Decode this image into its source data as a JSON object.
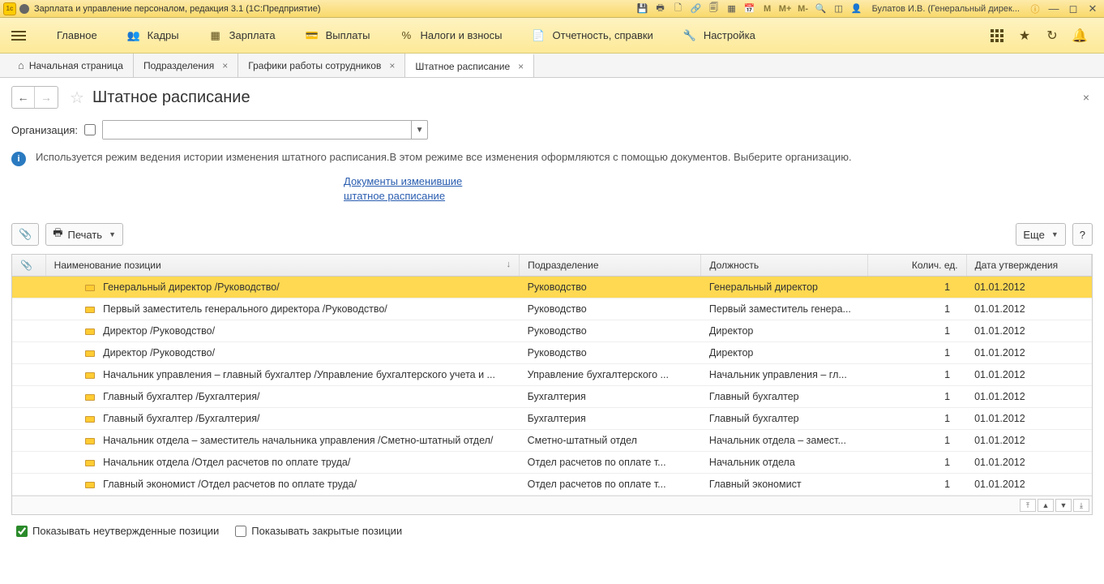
{
  "titlebar": {
    "app_title": "Зарплата и управление персоналом, редакция 3.1  (1С:Предприятие)",
    "user": "Булатов И.В. (Генеральный дирек..."
  },
  "menu": {
    "main": "Главное",
    "staff": "Кадры",
    "salary": "Зарплата",
    "payments": "Выплаты",
    "taxes": "Налоги и взносы",
    "reports": "Отчетность, справки",
    "settings": "Настройка"
  },
  "tabs": {
    "home": "Начальная страница",
    "t1": "Подразделения",
    "t2": "Графики работы сотрудников",
    "t3": "Штатное расписание"
  },
  "page": {
    "title": "Штатное расписание",
    "org_label": "Организация:",
    "info_text": "Используется режим ведения истории изменения штатного расписания.В этом режиме все изменения оформляются с помощью документов. Выберите организацию.",
    "doc_link1": "Документы изменившие",
    "doc_link2": "штатное расписание",
    "print_btn": "Печать",
    "more_btn": "Еще",
    "help_btn": "?",
    "show_unapproved": "Показывать неутвержденные позиции",
    "show_closed": "Показывать закрытые позиции"
  },
  "table": {
    "headers": {
      "attach": "",
      "name": "Наименование позиции",
      "dept": "Подразделение",
      "pos": "Должность",
      "qty": "Колич. ед.",
      "date": "Дата утверждения"
    },
    "rows": [
      {
        "name": "Генеральный директор /Руководство/",
        "dept": "Руководство",
        "pos": "Генеральный директор",
        "qty": "1",
        "date": "01.01.2012"
      },
      {
        "name": "Первый заместитель генерального директора /Руководство/",
        "dept": "Руководство",
        "pos": "Первый заместитель генера...",
        "qty": "1",
        "date": "01.01.2012"
      },
      {
        "name": "Директор /Руководство/",
        "dept": "Руководство",
        "pos": "Директор",
        "qty": "1",
        "date": "01.01.2012"
      },
      {
        "name": "Директор /Руководство/",
        "dept": "Руководство",
        "pos": "Директор",
        "qty": "1",
        "date": "01.01.2012"
      },
      {
        "name": "Начальник управления – главный бухгалтер /Управление бухгалтерского учета и ...",
        "dept": "Управление бухгалтерского ...",
        "pos": "Начальник управления – гл...",
        "qty": "1",
        "date": "01.01.2012"
      },
      {
        "name": "Главный бухгалтер /Бухгалтерия/",
        "dept": "Бухгалтерия",
        "pos": "Главный бухгалтер",
        "qty": "1",
        "date": "01.01.2012"
      },
      {
        "name": "Главный бухгалтер /Бухгалтерия/",
        "dept": "Бухгалтерия",
        "pos": "Главный бухгалтер",
        "qty": "1",
        "date": "01.01.2012"
      },
      {
        "name": "Начальник отдела – заместитель начальника управления /Сметно-штатный отдел/",
        "dept": "Сметно-штатный отдел",
        "pos": "Начальник отдела – замест...",
        "qty": "1",
        "date": "01.01.2012"
      },
      {
        "name": "Начальник отдела /Отдел расчетов по оплате труда/",
        "dept": "Отдел расчетов по оплате т...",
        "pos": "Начальник отдела",
        "qty": "1",
        "date": "01.01.2012"
      },
      {
        "name": "Главный экономист /Отдел расчетов по оплате труда/",
        "dept": "Отдел расчетов по оплате т...",
        "pos": "Главный экономист",
        "qty": "1",
        "date": "01.01.2012"
      }
    ]
  }
}
